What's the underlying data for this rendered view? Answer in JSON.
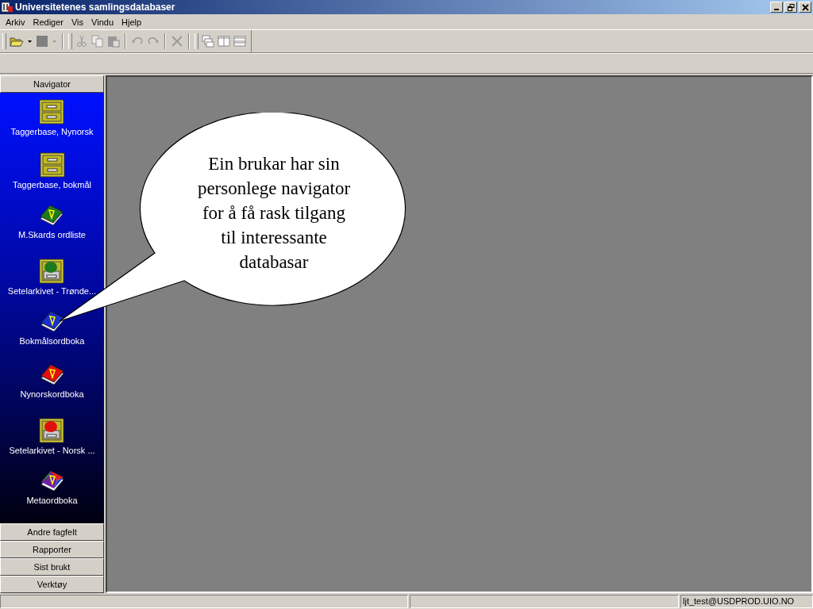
{
  "window": {
    "title": "Universitetenes samlingsdatabaser"
  },
  "menu": [
    "Arkiv",
    "Rediger",
    "Vis",
    "Vindu",
    "Hjelp"
  ],
  "navigator": {
    "header": "Navigator",
    "items": [
      {
        "label": "Taggerbase, Nynorsk",
        "kind": "cabinet"
      },
      {
        "label": "Taggerbase, bokmål",
        "kind": "cabinet"
      },
      {
        "label": "M.Skards ordliste",
        "kind": "book",
        "color": "#1e7a1e"
      },
      {
        "label": "Setelarkivet - Trønde...",
        "kind": "slipcabinet",
        "color": "#1e7a1e"
      },
      {
        "label": "Bokmålsordboka",
        "kind": "book",
        "color": "#1a2fd0"
      },
      {
        "label": "Nynorskordboka",
        "kind": "book",
        "color": "#e01010"
      },
      {
        "label": "Setelarkivet - Norsk ...",
        "kind": "slipcabinet",
        "color": "#e01010"
      },
      {
        "label": "Metaordboka",
        "kind": "multibook"
      }
    ]
  },
  "sections": [
    "Andre fagfelt",
    "Rapporter",
    "Sist brukt",
    "Verktøy"
  ],
  "callout": {
    "text": "Ein brukar har sin personlege navigator for å få rask tilgang til interessante databasar"
  },
  "status_bar": {
    "user": "ljt_test@USDPROD.UIO.NO"
  }
}
